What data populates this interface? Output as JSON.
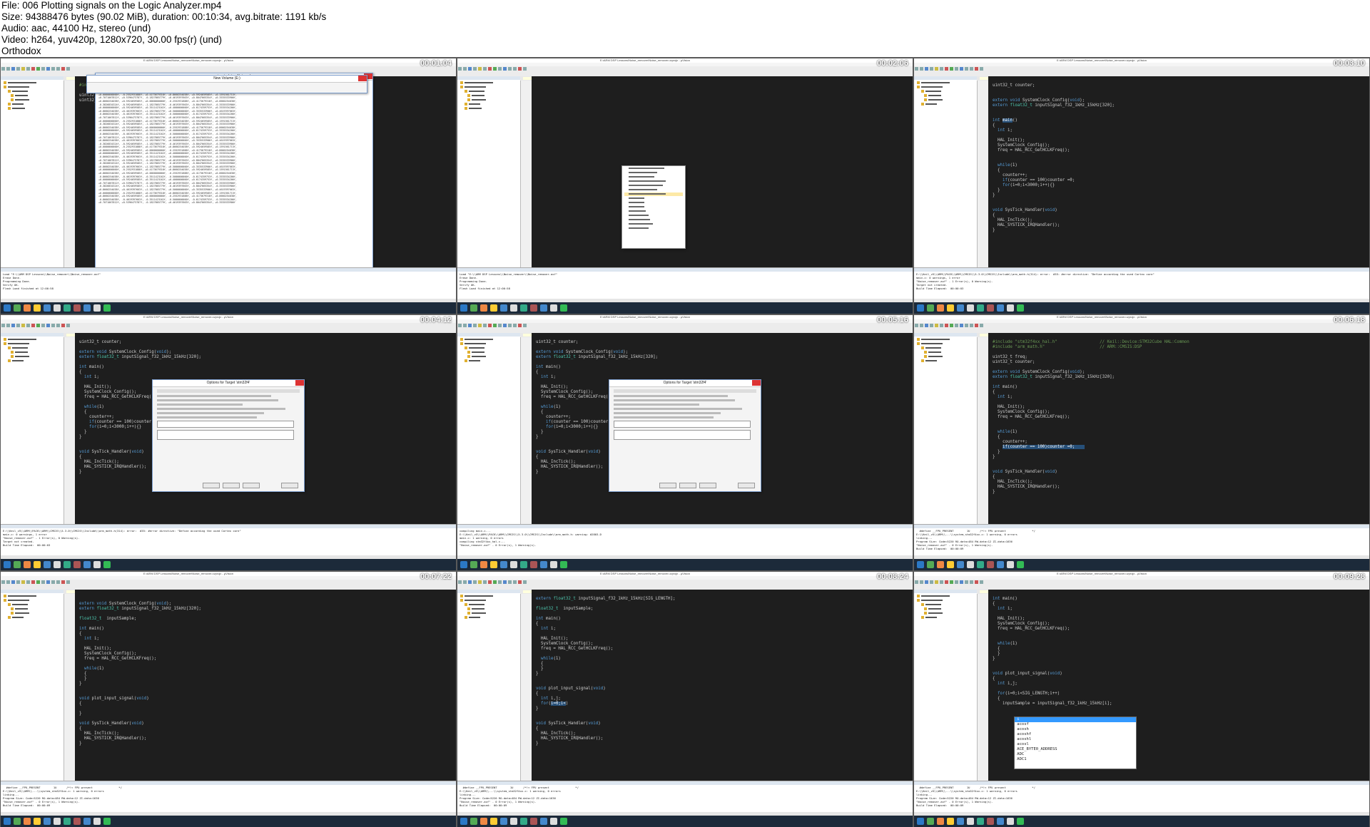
{
  "header": {
    "file_line": "File: 006 Plotting signals on the Logic Analyzer.mp4",
    "size_line": "Size: 94388476 bytes (90.02 MiB), duration: 00:10:34, avg.bitrate: 1191 kb/s",
    "audio_line": "Audio: aac, 44100 Hz, stereo (und)",
    "video_line": "Video: h264, yuv420p, 1280x720, 30.00 fps(r) (und)",
    "credit_line": "Orthodox"
  },
  "thumbnails": [
    {
      "timestamp": "00:01:04"
    },
    {
      "timestamp": "00:02:06"
    },
    {
      "timestamp": "00:03:10"
    },
    {
      "timestamp": "00:04:12"
    },
    {
      "timestamp": "00:05:16"
    },
    {
      "timestamp": "00:06:18"
    },
    {
      "timestamp": "00:07:22"
    },
    {
      "timestamp": "00:08:24"
    },
    {
      "timestamp": "00:09:28"
    }
  ]
}
